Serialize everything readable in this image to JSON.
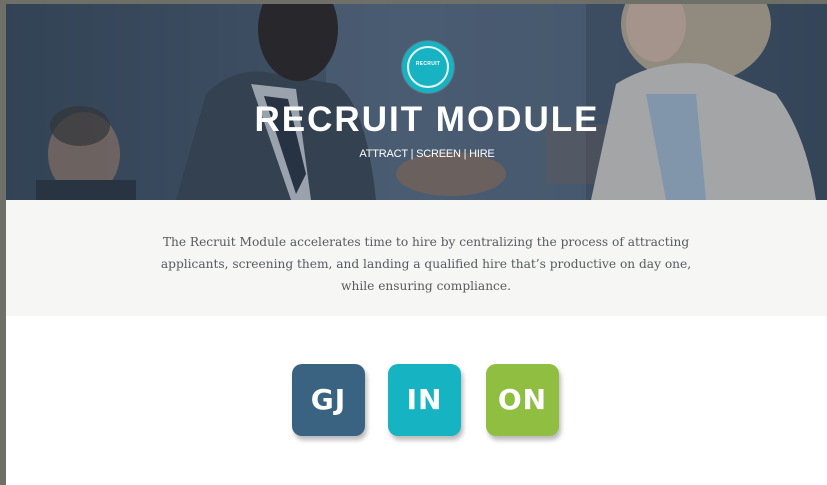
{
  "hero": {
    "badge_text": "RECRUIT",
    "title": "RECRUIT MODULE",
    "subtitle": "ATTRACT | SCREEN | HIRE",
    "badge_color": "#17b3c2"
  },
  "description": {
    "text": "The Recruit Module accelerates time to hire by centralizing the process of attracting applicants, screening them, and landing a qualified hire that’s productive on day one, while ensuring compliance."
  },
  "tiles": [
    {
      "label": "GJ",
      "color": "#3a6281"
    },
    {
      "label": "IN",
      "color": "#16b3c3"
    },
    {
      "label": "ON",
      "color": "#8fbe41"
    }
  ]
}
